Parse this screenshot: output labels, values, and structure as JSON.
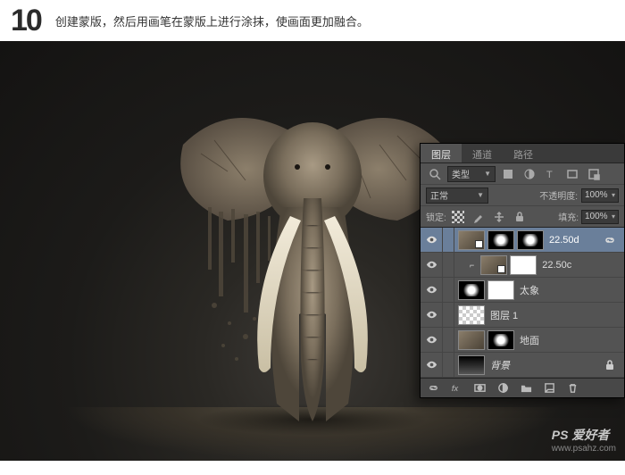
{
  "header": {
    "step_number": "10",
    "instruction": "创建蒙版，然后用画笔在蒙版上进行涂抹，使画面更加融合。"
  },
  "watermark": {
    "brand": "PS 爱好者",
    "url": "www.psahz.com"
  },
  "panel": {
    "tabs": {
      "layers": "图层",
      "channels": "通道",
      "paths": "路径"
    },
    "filter_row": {
      "kind": "类型"
    },
    "blend_row": {
      "mode": "正常",
      "opacity_label": "不透明度:",
      "opacity_value": "100%"
    },
    "lock_row": {
      "label": "锁定:",
      "fill_label": "填充:",
      "fill_value": "100%"
    },
    "layers": [
      {
        "name": "22.50d",
        "selected": true,
        "thumbs": [
          "img",
          "mask",
          "mask"
        ],
        "linked": true
      },
      {
        "name": "22.50c",
        "clipped": true,
        "indent": true,
        "thumbs": [
          "img",
          "white"
        ],
        "smart": true
      },
      {
        "name": "太象",
        "thumbs": [
          "mask",
          "white"
        ]
      },
      {
        "name": "图层 1",
        "thumbs": [
          "checker"
        ]
      },
      {
        "name": "地面",
        "thumbs": [
          "img",
          "mask"
        ]
      },
      {
        "name": "背景",
        "thumbs": [
          "grad"
        ],
        "locked": true
      }
    ]
  }
}
